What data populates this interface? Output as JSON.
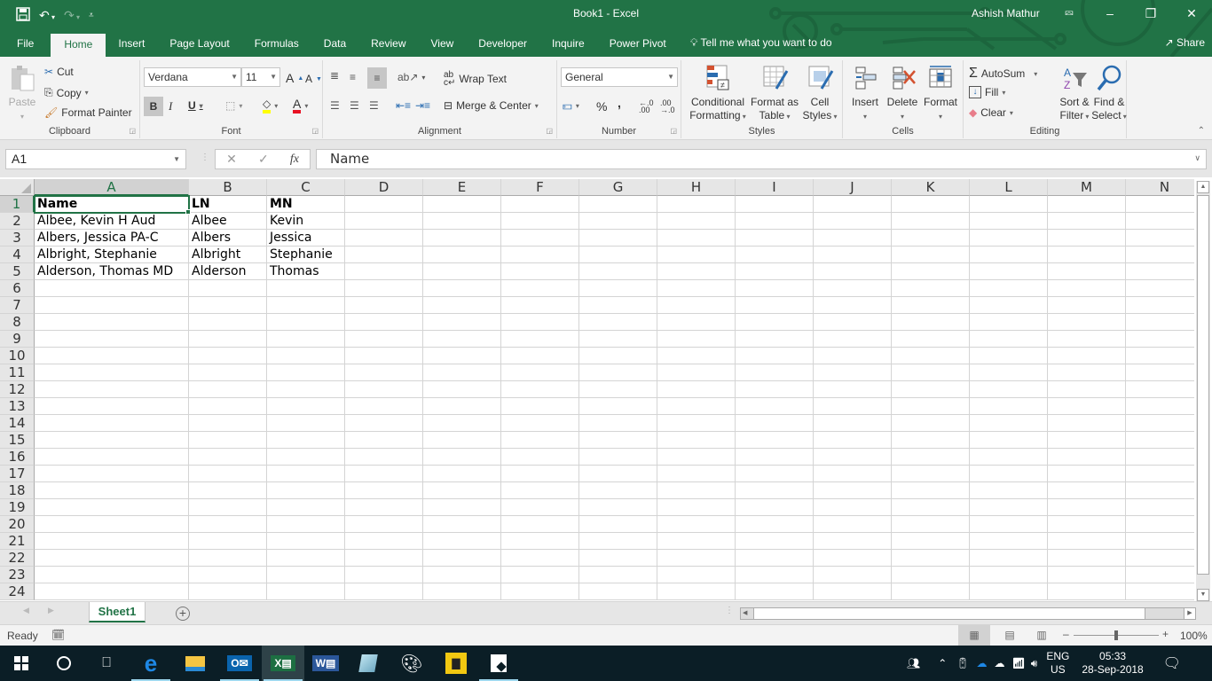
{
  "app": {
    "window_title": "Book1  -  Excel",
    "user_name": "Ashish Mathur",
    "brand_color": "#217346"
  },
  "quick_access": {
    "icons": [
      "save-icon",
      "undo-icon",
      "redo-icon",
      "customize-qat-icon"
    ]
  },
  "ribbon_tabs": [
    {
      "label": "File",
      "active": false
    },
    {
      "label": "Home",
      "active": true
    },
    {
      "label": "Insert",
      "active": false
    },
    {
      "label": "Page Layout",
      "active": false
    },
    {
      "label": "Formulas",
      "active": false
    },
    {
      "label": "Data",
      "active": false
    },
    {
      "label": "Review",
      "active": false
    },
    {
      "label": "View",
      "active": false
    },
    {
      "label": "Developer",
      "active": false
    },
    {
      "label": "Inquire",
      "active": false
    },
    {
      "label": "Power Pivot",
      "active": false
    }
  ],
  "tell_me": "Tell me what you want to do",
  "share_label": "Share",
  "ribbon": {
    "clipboard": {
      "label": "Clipboard",
      "paste": "Paste",
      "cut": "Cut",
      "copy": "Copy",
      "format_painter": "Format Painter"
    },
    "font": {
      "label": "Font",
      "font_name": "Verdana",
      "font_size": "11",
      "bold": "B",
      "italic": "I",
      "underline": "U",
      "grow": "A",
      "shrink": "A",
      "font_color": "A",
      "fill_color_hex": "#ffff00",
      "font_color_hex": "#e81123"
    },
    "alignment": {
      "label": "Alignment",
      "wrap_text": "Wrap Text",
      "merge_center": "Merge & Center"
    },
    "number": {
      "label": "Number",
      "format": "General",
      "percent": "%",
      "comma": ","
    },
    "styles": {
      "label": "Styles",
      "conditional_formatting": [
        "Conditional",
        "Formatting"
      ],
      "format_as_table": [
        "Format as",
        "Table"
      ],
      "cell_styles": [
        "Cell",
        "Styles"
      ]
    },
    "cells": {
      "label": "Cells",
      "insert": "Insert",
      "delete": "Delete",
      "format": "Format"
    },
    "editing": {
      "label": "Editing",
      "autosum": "AutoSum",
      "fill": "Fill",
      "clear": "Clear",
      "sort_filter": [
        "Sort &",
        "Filter"
      ],
      "find_select": [
        "Find &",
        "Select"
      ]
    }
  },
  "formula_bar": {
    "name_box": "A1",
    "formula": "Name",
    "fx": "fx"
  },
  "sheet": {
    "columns": [
      "A",
      "B",
      "C",
      "D",
      "E",
      "F",
      "G",
      "H",
      "I",
      "J",
      "K",
      "L",
      "M",
      "N"
    ],
    "rows": [
      "1",
      "2",
      "3",
      "4",
      "5",
      "6",
      "7",
      "8",
      "9",
      "10",
      "11",
      "12",
      "13",
      "14",
      "15",
      "16",
      "17",
      "18",
      "19",
      "20",
      "21",
      "22",
      "23",
      "24"
    ],
    "selected_cell": "A1",
    "cells": [
      [
        "Name",
        "LN",
        "MN"
      ],
      [
        "Albee, Kevin H Aud",
        "Albee",
        "Kevin"
      ],
      [
        "Albers, Jessica PA-C",
        "Albers",
        "Jessica"
      ],
      [
        "Albright, Stephanie",
        "Albright",
        "Stephanie"
      ],
      [
        "Alderson, Thomas MD",
        "Alderson",
        "Thomas"
      ]
    ]
  },
  "sheet_tabs": [
    {
      "label": "Sheet1",
      "active": true
    }
  ],
  "status": {
    "ready": "Ready",
    "zoom": "100%",
    "zoom_fraction": 0.5
  },
  "taskbar": {
    "apps": [
      "windows-start",
      "cortana",
      "task-view",
      "edge",
      "file-explorer",
      "outlook",
      "excel",
      "word",
      "notepad",
      "paint",
      "power-bi",
      "sticky-notes"
    ],
    "active_app": "excel",
    "language": [
      "ENG",
      "US"
    ],
    "time": "05:33",
    "date": "28-Sep-2018"
  }
}
